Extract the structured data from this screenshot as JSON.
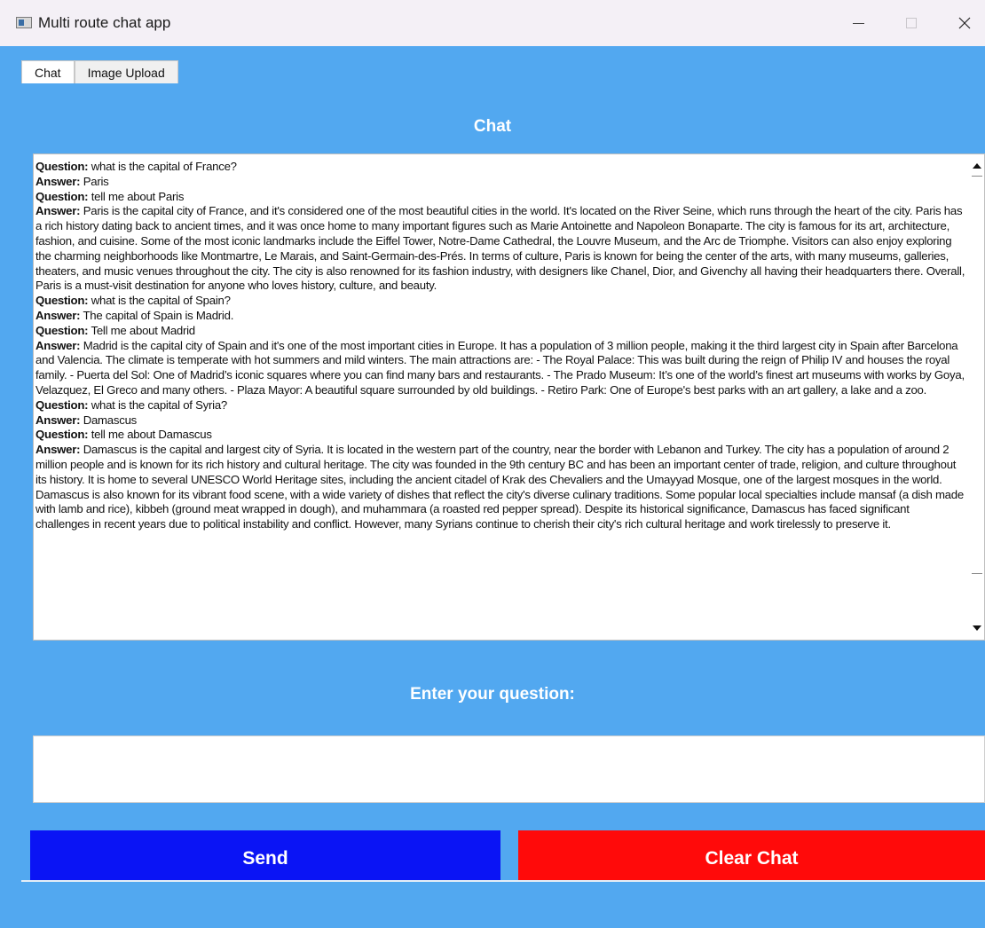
{
  "window": {
    "title": "Multi route chat app",
    "controls": {
      "minimize": "minimize",
      "maximize": "maximize",
      "close": "close"
    }
  },
  "tabs": [
    {
      "label": "Chat",
      "active": true
    },
    {
      "label": "Image Upload",
      "active": false
    }
  ],
  "chat": {
    "title": "Chat",
    "question_label": "Question:",
    "answer_label": "Answer:",
    "entries": [
      {
        "q": "what is the capital of France?",
        "a": "Paris"
      },
      {
        "q": "tell me about Paris",
        "a": "Paris is the capital city of France, and it's considered one of the most beautiful cities in the world. It's located on the River Seine, which runs through the heart of the city. Paris has a rich history dating back to ancient times, and it was once home to many important figures such as Marie Antoinette and Napoleon Bonaparte. The city is famous for its art, architecture, fashion, and cuisine. Some of the most iconic landmarks include the Eiffel Tower, Notre-Dame Cathedral, the Louvre Museum, and the Arc de Triomphe. Visitors can also enjoy exploring the charming neighborhoods like Montmartre, Le Marais, and Saint-Germain-des-Prés. In terms of culture, Paris is known for being the center of the arts, with many museums, galleries, theaters, and music venues throughout the city. The city is also renowned for its fashion industry, with designers like Chanel, Dior, and Givenchy all having their headquarters there. Overall, Paris is a must-visit destination for anyone who loves history, culture, and beauty."
      },
      {
        "q": "what is the capital of Spain?",
        "a": "The capital of Spain is Madrid."
      },
      {
        "q": "Tell me about Madrid",
        "a": "Madrid is the capital city of Spain and it's one of the most important cities in Europe. It has a population of 3 million people, making it the third largest city in Spain after Barcelona and Valencia. The climate is temperate with hot summers and mild winters. The main attractions are: - The Royal Palace: This was built during the reign of Philip IV and houses the royal family. - Puerta del Sol: One of Madrid’s iconic squares where you can find many bars and restaurants. - The Prado Museum: It’s one of the world’s finest art museums with works by Goya, Velazquez, El Greco and many others. - Plaza Mayor: A beautiful square surrounded by old buildings. - Retiro Park: One of Europe's best parks with an art gallery, a lake and a zoo."
      },
      {
        "q": "what is the capital of Syria?",
        "a": "Damascus"
      },
      {
        "q": "tell me about Damascus",
        "a": "Damascus is the capital and largest city of Syria. It is located in the western part of the country, near the border with Lebanon and Turkey. The city has a population of around 2 million people and is known for its rich history and cultural heritage. The city was founded in the 9th century BC and has been an important center of trade, religion, and culture throughout its history. It is home to several UNESCO World Heritage sites, including the ancient citadel of Krak des Chevaliers and the Umayyad Mosque, one of the largest mosques in the world. Damascus is also known for its vibrant food scene, with a wide variety of dishes that reflect the city's diverse culinary traditions. Some popular local specialties include mansaf (a dish made with lamb and rice), kibbeh (ground meat wrapped in dough), and muhammara (a roasted red pepper spread). Despite its historical significance, Damascus has faced significant challenges in recent years due to political instability and conflict. However, many Syrians continue to cherish their city's rich cultural heritage and work tirelessly to preserve it."
      }
    ]
  },
  "input": {
    "title": "Enter your question:",
    "value": ""
  },
  "buttons": {
    "send": "Send",
    "clear": "Clear Chat"
  },
  "colors": {
    "background": "#52a8f0",
    "send": "#0a14f5",
    "clear": "#ff0a0a"
  }
}
